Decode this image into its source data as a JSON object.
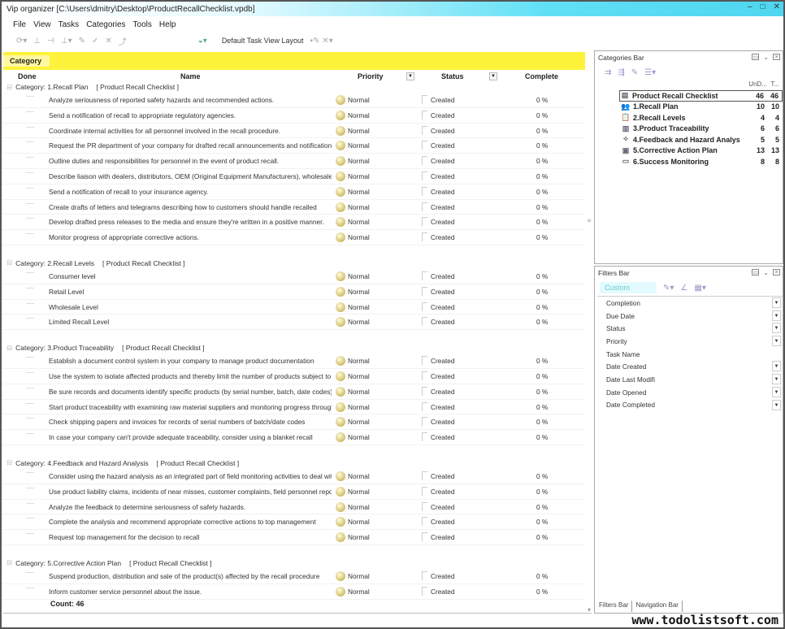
{
  "window": {
    "title": "Vip organizer [C:\\Users\\dmitry\\Desktop\\ProductRecallChecklist.vpdb]",
    "controls": [
      "–",
      "□",
      "✕"
    ]
  },
  "menu": [
    "File",
    "View",
    "Tasks",
    "Categories",
    "Tools",
    "Help"
  ],
  "toolbar": {
    "layout_label": "Default Task View Layout"
  },
  "group_bar": {
    "label": "Category"
  },
  "columns": {
    "done": "Done",
    "name": "Name",
    "priority": "Priority",
    "status": "Status",
    "complete": "Complete"
  },
  "groups": [
    {
      "label": "Category: 1.Recall Plan",
      "checklist": "[ Product Recall Checklist ]",
      "tasks": [
        "Analyze seriousness of reported safety hazards and recommended actions.",
        "Send a notification of recall to appropriate regulatory agencies.",
        "Coordinate internal activities for all personnel involved in the recall procedure.",
        "Request the PR department of your company for drafted recall announcements and notifications.",
        "Outline duties and responsibilities for personnel in the event of product recall.",
        "Describe liaison with dealers, distributors, OEM (Original Equipment Manufacturers), wholesalers.",
        "Send a notification of recall to your insurance agency.",
        "Create drafts of letters and telegrams describing how to customers should handle recalled",
        "Develop drafted press releases to the media and ensure they're written in a positive manner.",
        "Monitor progress of appropriate corrective actions."
      ]
    },
    {
      "label": "Category: 2.Recall Levels",
      "checklist": "[ Product Recall Checklist ]",
      "tasks": [
        "Consumer level",
        "Retail Level",
        "Wholesale Level",
        "Limited Recall Level"
      ]
    },
    {
      "label": "Category: 3.Product Traceability",
      "checklist": "[ Product Recall Checklist ]",
      "tasks": [
        "Establish a document control system in your company to manage product documentation",
        "Use the system to isolate affected products and thereby limit the number of products subject to",
        "Be sure records and documents identify specific products (by serial number, batch, date codes)",
        "Start product traceability with examining raw material suppliers and monitoring progress through the",
        "Check shipping papers and invoices for records of serial numbers of batch/date codes",
        "In case your company can't provide adequate traceability, consider using a blanket recall"
      ]
    },
    {
      "label": "Category: 4.Feedback and Hazard Analysis",
      "checklist": "[ Product Recall Checklist ]",
      "tasks": [
        "Consider using the hazard analysis as an integrated part of field monitoring activities to deal with",
        "Use product liability claims, incidents of near misses, customer complaints, field personnel reports,",
        "Analyze the feedback to determine seriousness of safety hazards.",
        "Complete the analysis and recommend appropriate corrective actions to top management",
        "Request top management for the decision to recall"
      ]
    },
    {
      "label": "Category: 5.Corrective Action Plan",
      "checklist": "[ Product Recall Checklist ]",
      "tasks": [
        "Suspend production, distribution and sale of the product(s) affected by the recall procedure",
        "Inform customer service personnel about the issue."
      ]
    }
  ],
  "task_defaults": {
    "priority": "Normal",
    "status": "Created",
    "complete": "0 %"
  },
  "count_label": "Count: 46",
  "categories_bar": {
    "title": "Categories Bar",
    "col_undone": "UnD...",
    "col_total": "T...",
    "items": [
      {
        "label": "Product Recall Checklist",
        "undone": "46",
        "total": "46",
        "icon": "checklist-icon"
      },
      {
        "label": "1.Recall Plan",
        "undone": "10",
        "total": "10",
        "icon": "people-icon"
      },
      {
        "label": "2.Recall Levels",
        "undone": "4",
        "total": "4",
        "icon": "clipboard-icon"
      },
      {
        "label": "3.Product Traceability",
        "undone": "6",
        "total": "6",
        "icon": "map-icon"
      },
      {
        "label": "4.Feedback and Hazard Analys",
        "undone": "5",
        "total": "5",
        "icon": "feedback-icon"
      },
      {
        "label": "5.Corrective Action Plan",
        "undone": "13",
        "total": "13",
        "icon": "toolbox-icon"
      },
      {
        "label": "6.Success Monitoring",
        "undone": "8",
        "total": "8",
        "icon": "monitor-icon"
      }
    ]
  },
  "filters_bar": {
    "title": "Filters Bar",
    "preset": "Custom",
    "filters": [
      {
        "label": "Completion",
        "dropdown": true
      },
      {
        "label": "Due Date",
        "dropdown": true
      },
      {
        "label": "Status",
        "dropdown": true
      },
      {
        "label": "Priority",
        "dropdown": true
      },
      {
        "label": "Task Name",
        "dropdown": false
      },
      {
        "label": "Date Created",
        "dropdown": true
      },
      {
        "label": "Date Last Modifi",
        "dropdown": true
      },
      {
        "label": "Date Opened",
        "dropdown": true
      },
      {
        "label": "Date Completed",
        "dropdown": true
      }
    ]
  },
  "bottom_tabs": [
    "Filters Bar",
    "Navigation Bar"
  ],
  "watermark": "www.todolistsoft.com",
  "colors": {
    "group_bar": "#fdf33a",
    "title_accent": "#4fd6f0"
  }
}
